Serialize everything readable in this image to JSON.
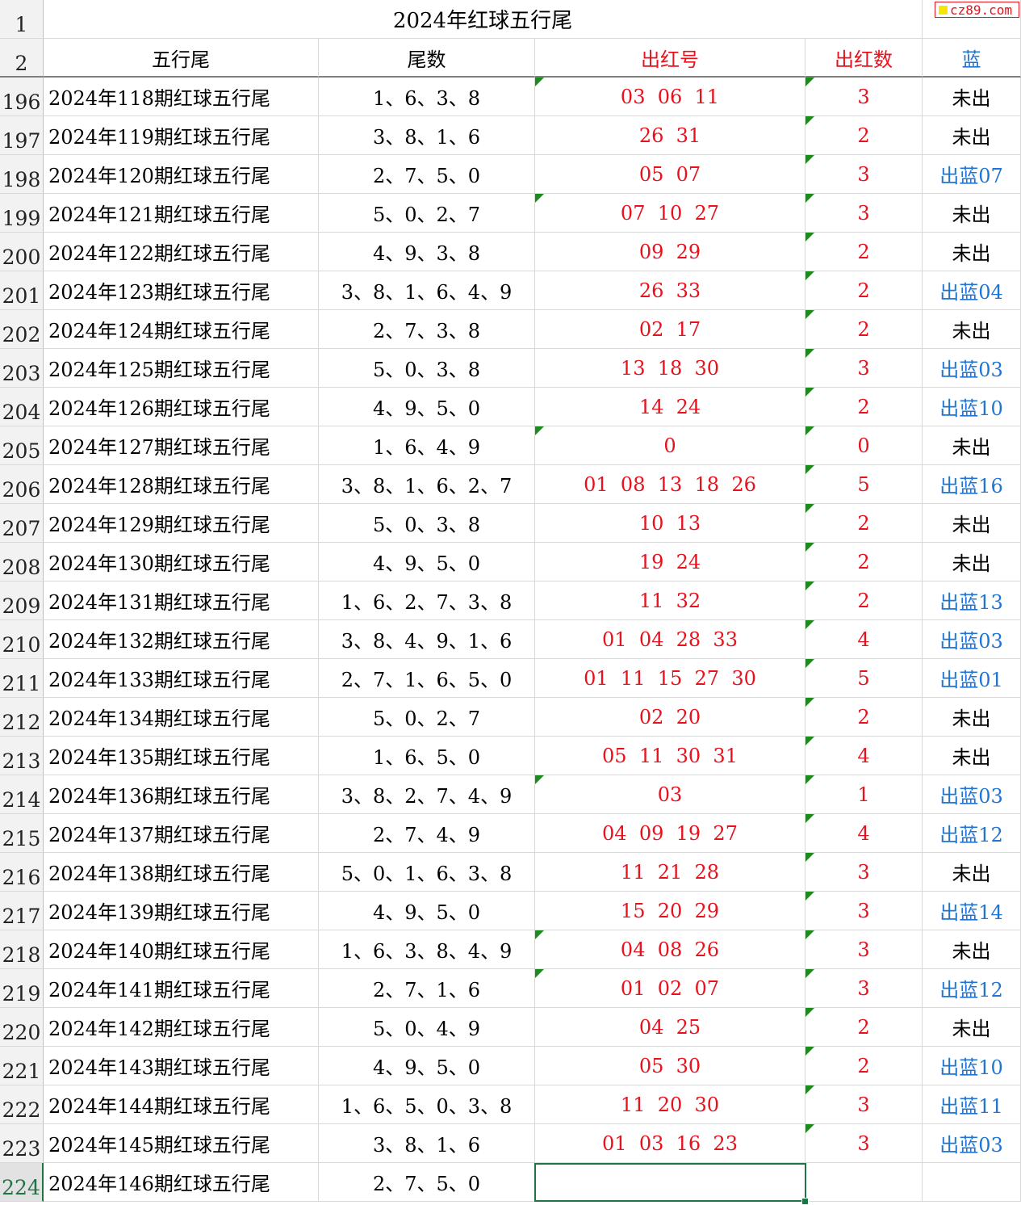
{
  "sheet": {
    "title": "2024年红球五行尾",
    "title_row_number": "1",
    "header_row_number": "2",
    "headers": {
      "wuxing": "五行尾",
      "weishu": "尾数",
      "chuhong": "出红号",
      "chuhongshu": "出红数",
      "lan": "蓝"
    },
    "active_row": "224",
    "rows": [
      {
        "num": "196",
        "period": "2024年118期红球五行尾",
        "tail": "1、6、3、8",
        "red": "03  06  11",
        "count": "3",
        "blue": "未出"
      },
      {
        "num": "197",
        "period": "2024年119期红球五行尾",
        "tail": "3、8、1、6",
        "red": "26  31",
        "count": "2",
        "blue": "未出"
      },
      {
        "num": "198",
        "period": "2024年120期红球五行尾",
        "tail": "2、7、5、0",
        "red": "05  07",
        "count": "3",
        "blue": "出蓝07"
      },
      {
        "num": "199",
        "period": "2024年121期红球五行尾",
        "tail": "5、0、2、7",
        "red": "07  10  27",
        "count": "3",
        "blue": "未出"
      },
      {
        "num": "200",
        "period": "2024年122期红球五行尾",
        "tail": "4、9、3、8",
        "red": "09  29",
        "count": "2",
        "blue": "未出"
      },
      {
        "num": "201",
        "period": "2024年123期红球五行尾",
        "tail": "3、8、1、6、4、9",
        "red": "26  33",
        "count": "2",
        "blue": "出蓝04"
      },
      {
        "num": "202",
        "period": "2024年124期红球五行尾",
        "tail": "2、7、3、8",
        "red": "02  17",
        "count": "2",
        "blue": "未出"
      },
      {
        "num": "203",
        "period": "2024年125期红球五行尾",
        "tail": "5、0、3、8",
        "red": "13  18  30",
        "count": "3",
        "blue": "出蓝03"
      },
      {
        "num": "204",
        "period": "2024年126期红球五行尾",
        "tail": "4、9、5、0",
        "red": "14  24",
        "count": "2",
        "blue": "出蓝10"
      },
      {
        "num": "205",
        "period": "2024年127期红球五行尾",
        "tail": "1、6、4、9",
        "red": "0",
        "count": "0",
        "blue": "未出"
      },
      {
        "num": "206",
        "period": "2024年128期红球五行尾",
        "tail": "3、8、1、6、2、7",
        "red": "01  08  13  18  26",
        "count": "5",
        "blue": "出蓝16"
      },
      {
        "num": "207",
        "period": "2024年129期红球五行尾",
        "tail": "5、0、3、8",
        "red": "10  13",
        "count": "2",
        "blue": "未出"
      },
      {
        "num": "208",
        "period": "2024年130期红球五行尾",
        "tail": "4、9、5、0",
        "red": "19  24",
        "count": "2",
        "blue": "未出"
      },
      {
        "num": "209",
        "period": "2024年131期红球五行尾",
        "tail": "1、6、2、7、3、8",
        "red": "11  32",
        "count": "2",
        "blue": "出蓝13"
      },
      {
        "num": "210",
        "period": "2024年132期红球五行尾",
        "tail": "3、8、4、9、1、6",
        "red": "01  04  28  33",
        "count": "4",
        "blue": "出蓝03"
      },
      {
        "num": "211",
        "period": "2024年133期红球五行尾",
        "tail": "2、7、1、6、5、0",
        "red": "01  11  15  27  30",
        "count": "5",
        "blue": "出蓝01"
      },
      {
        "num": "212",
        "period": "2024年134期红球五行尾",
        "tail": "5、0、2、7",
        "red": "02  20",
        "count": "2",
        "blue": "未出"
      },
      {
        "num": "213",
        "period": "2024年135期红球五行尾",
        "tail": "1、6、5、0",
        "red": "05  11  30  31",
        "count": "4",
        "blue": "未出"
      },
      {
        "num": "214",
        "period": "2024年136期红球五行尾",
        "tail": "3、8、2、7、4、9",
        "red": "03",
        "count": "1",
        "blue": "出蓝03"
      },
      {
        "num": "215",
        "period": "2024年137期红球五行尾",
        "tail": "2、7、4、9",
        "red": "04  09  19  27",
        "count": "4",
        "blue": "出蓝12"
      },
      {
        "num": "216",
        "period": "2024年138期红球五行尾",
        "tail": "5、0、1、6、3、8",
        "red": "11  21  28",
        "count": "3",
        "blue": "未出"
      },
      {
        "num": "217",
        "period": "2024年139期红球五行尾",
        "tail": "4、9、5、0",
        "red": "15  20  29",
        "count": "3",
        "blue": "出蓝14"
      },
      {
        "num": "218",
        "period": "2024年140期红球五行尾",
        "tail": "1、6、3、8、4、9",
        "red": "04  08  26",
        "count": "3",
        "blue": "未出"
      },
      {
        "num": "219",
        "period": "2024年141期红球五行尾",
        "tail": "2、7、1、6",
        "red": "01  02  07",
        "count": "3",
        "blue": "出蓝12"
      },
      {
        "num": "220",
        "period": "2024年142期红球五行尾",
        "tail": "5、0、4、9",
        "red": "04  25",
        "count": "2",
        "blue": "未出"
      },
      {
        "num": "221",
        "period": "2024年143期红球五行尾",
        "tail": "4、9、5、0",
        "red": "05  30",
        "count": "2",
        "blue": "出蓝10"
      },
      {
        "num": "222",
        "period": "2024年144期红球五行尾",
        "tail": "1、6、5、0、3、8",
        "red": "11  20  30",
        "count": "3",
        "blue": "出蓝11"
      },
      {
        "num": "223",
        "period": "2024年145期红球五行尾",
        "tail": "3、8、1、6",
        "red": "01  03  16  23",
        "count": "3",
        "blue": "出蓝03"
      },
      {
        "num": "224",
        "period": "2024年146期红球五行尾",
        "tail": "2、7、5、0",
        "red": "",
        "count": "",
        "blue": ""
      }
    ],
    "triangles_red_col_rows": [
      "196",
      "199",
      "205",
      "214",
      "218",
      "219"
    ]
  },
  "watermark": {
    "text": "cz89.com"
  },
  "colors": {
    "red": "#e8111c",
    "blue": "#1f74d4",
    "indicator": "#1e8a1e",
    "selection": "#217346"
  }
}
